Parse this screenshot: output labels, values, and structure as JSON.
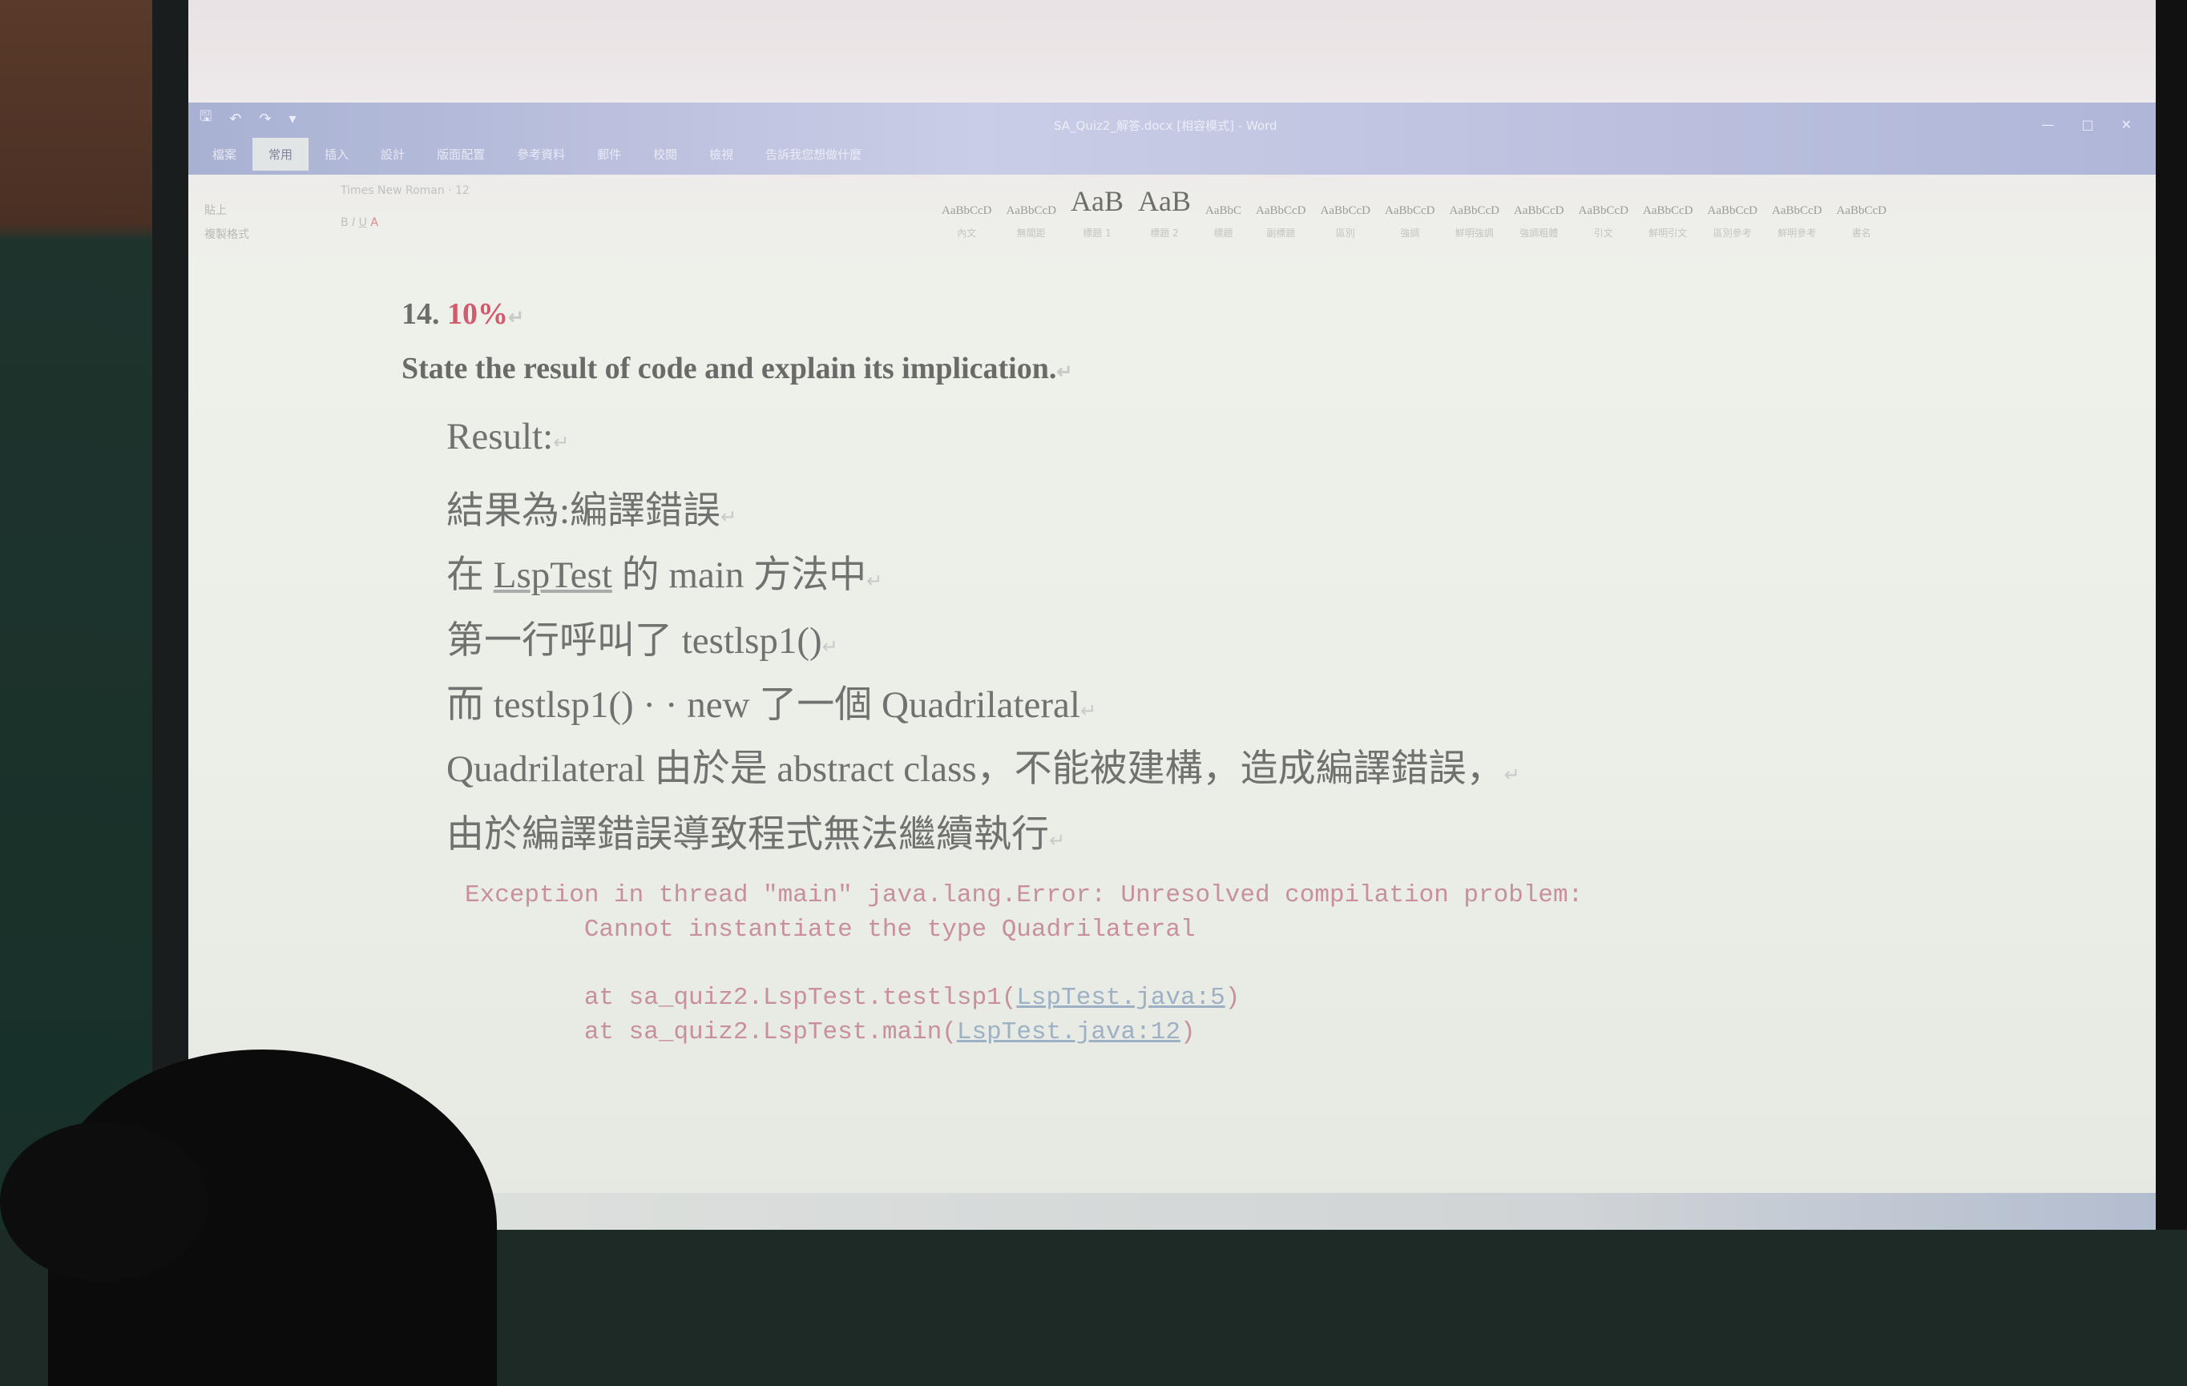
{
  "window": {
    "title": "SA_Quiz2_解答.docx [相容模式] - Word",
    "quick_access": [
      "save-icon",
      "undo-icon",
      "redo-icon",
      "customize-icon"
    ],
    "controls": [
      "—",
      "□",
      "✕"
    ]
  },
  "tabs": [
    "檔案",
    "常用",
    "插入",
    "設計",
    "版面配置",
    "參考資料",
    "郵件",
    "校閱",
    "檢視",
    "告訴我您想做什麼"
  ],
  "ribbon": {
    "clipboard": "貼上",
    "format_painter": "複製格式",
    "font_name": "Times New Roman",
    "font_size": "12",
    "styles": [
      {
        "sample": "AaBbCcD",
        "name": "內文"
      },
      {
        "sample": "AaBbCcD",
        "name": "無間距"
      },
      {
        "sample": "AaB",
        "name": "標題 1"
      },
      {
        "sample": "AaB",
        "name": "標題 2"
      },
      {
        "sample": "AaBbC",
        "name": "標題"
      },
      {
        "sample": "AaBbCcD",
        "name": "副標題"
      },
      {
        "sample": "AaBbCcD",
        "name": "區別"
      },
      {
        "sample": "AaBbCcD",
        "name": "強調"
      },
      {
        "sample": "AaBbCcD",
        "name": "鮮明強調"
      },
      {
        "sample": "AaBbCcD",
        "name": "強調粗體"
      },
      {
        "sample": "AaBbCcD",
        "name": "引文"
      },
      {
        "sample": "AaBbCcD",
        "name": "鮮明引文"
      },
      {
        "sample": "AaBbCcD",
        "name": "區別參考"
      },
      {
        "sample": "AaBbCcD",
        "name": "鮮明參考"
      },
      {
        "sample": "AaBbCcD",
        "name": "書名"
      }
    ]
  },
  "document": {
    "question_number": "14.",
    "percent": "10%",
    "instruction": "State the result of code and explain its implication.",
    "result_label": "Result:",
    "lines": [
      "結果為:編譯錯誤",
      "第一行呼叫了 testlsp1()",
      "而 testlsp1() · · new 了一個 Quadrilateral",
      "Quadrilateral 由於是 abstract class，不能被建構，造成編譯錯誤，",
      "由於編譯錯誤導致程式無法繼續執行"
    ],
    "line_main": {
      "prefix": "在 ",
      "link": "LspTest",
      "suffix": " 的 main 方法中"
    },
    "console": {
      "line1": "Exception in thread \"main\" java.lang.Error: Unresolved compilation problem:",
      "line2": "        Cannot instantiate the type Quadrilateral",
      "trace1_prefix": "        at sa_quiz2.LspTest.testlsp1(",
      "trace1_link": "LspTest.java:5",
      "trace2_prefix": "        at sa_quiz2.LspTest.main(",
      "trace2_link": "LspTest.java:12",
      "close": ")"
    }
  }
}
